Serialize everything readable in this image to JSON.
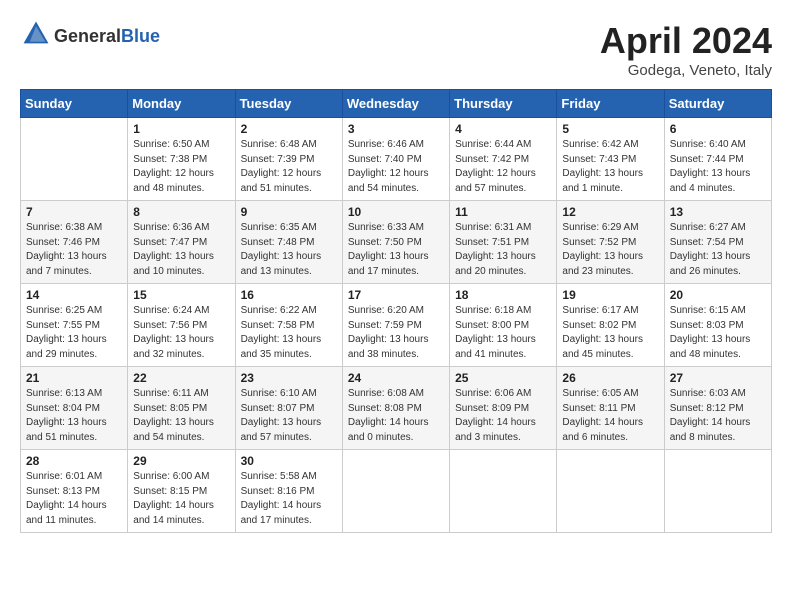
{
  "header": {
    "logo_line1": "General",
    "logo_line2": "Blue",
    "title": "April 2024",
    "subtitle": "Godega, Veneto, Italy"
  },
  "days_of_week": [
    "Sunday",
    "Monday",
    "Tuesday",
    "Wednesday",
    "Thursday",
    "Friday",
    "Saturday"
  ],
  "weeks": [
    [
      {
        "day": "",
        "info": ""
      },
      {
        "day": "1",
        "info": "Sunrise: 6:50 AM\nSunset: 7:38 PM\nDaylight: 12 hours\nand 48 minutes."
      },
      {
        "day": "2",
        "info": "Sunrise: 6:48 AM\nSunset: 7:39 PM\nDaylight: 12 hours\nand 51 minutes."
      },
      {
        "day": "3",
        "info": "Sunrise: 6:46 AM\nSunset: 7:40 PM\nDaylight: 12 hours\nand 54 minutes."
      },
      {
        "day": "4",
        "info": "Sunrise: 6:44 AM\nSunset: 7:42 PM\nDaylight: 12 hours\nand 57 minutes."
      },
      {
        "day": "5",
        "info": "Sunrise: 6:42 AM\nSunset: 7:43 PM\nDaylight: 13 hours\nand 1 minute."
      },
      {
        "day": "6",
        "info": "Sunrise: 6:40 AM\nSunset: 7:44 PM\nDaylight: 13 hours\nand 4 minutes."
      }
    ],
    [
      {
        "day": "7",
        "info": "Sunrise: 6:38 AM\nSunset: 7:46 PM\nDaylight: 13 hours\nand 7 minutes."
      },
      {
        "day": "8",
        "info": "Sunrise: 6:36 AM\nSunset: 7:47 PM\nDaylight: 13 hours\nand 10 minutes."
      },
      {
        "day": "9",
        "info": "Sunrise: 6:35 AM\nSunset: 7:48 PM\nDaylight: 13 hours\nand 13 minutes."
      },
      {
        "day": "10",
        "info": "Sunrise: 6:33 AM\nSunset: 7:50 PM\nDaylight: 13 hours\nand 17 minutes."
      },
      {
        "day": "11",
        "info": "Sunrise: 6:31 AM\nSunset: 7:51 PM\nDaylight: 13 hours\nand 20 minutes."
      },
      {
        "day": "12",
        "info": "Sunrise: 6:29 AM\nSunset: 7:52 PM\nDaylight: 13 hours\nand 23 minutes."
      },
      {
        "day": "13",
        "info": "Sunrise: 6:27 AM\nSunset: 7:54 PM\nDaylight: 13 hours\nand 26 minutes."
      }
    ],
    [
      {
        "day": "14",
        "info": "Sunrise: 6:25 AM\nSunset: 7:55 PM\nDaylight: 13 hours\nand 29 minutes."
      },
      {
        "day": "15",
        "info": "Sunrise: 6:24 AM\nSunset: 7:56 PM\nDaylight: 13 hours\nand 32 minutes."
      },
      {
        "day": "16",
        "info": "Sunrise: 6:22 AM\nSunset: 7:58 PM\nDaylight: 13 hours\nand 35 minutes."
      },
      {
        "day": "17",
        "info": "Sunrise: 6:20 AM\nSunset: 7:59 PM\nDaylight: 13 hours\nand 38 minutes."
      },
      {
        "day": "18",
        "info": "Sunrise: 6:18 AM\nSunset: 8:00 PM\nDaylight: 13 hours\nand 41 minutes."
      },
      {
        "day": "19",
        "info": "Sunrise: 6:17 AM\nSunset: 8:02 PM\nDaylight: 13 hours\nand 45 minutes."
      },
      {
        "day": "20",
        "info": "Sunrise: 6:15 AM\nSunset: 8:03 PM\nDaylight: 13 hours\nand 48 minutes."
      }
    ],
    [
      {
        "day": "21",
        "info": "Sunrise: 6:13 AM\nSunset: 8:04 PM\nDaylight: 13 hours\nand 51 minutes."
      },
      {
        "day": "22",
        "info": "Sunrise: 6:11 AM\nSunset: 8:05 PM\nDaylight: 13 hours\nand 54 minutes."
      },
      {
        "day": "23",
        "info": "Sunrise: 6:10 AM\nSunset: 8:07 PM\nDaylight: 13 hours\nand 57 minutes."
      },
      {
        "day": "24",
        "info": "Sunrise: 6:08 AM\nSunset: 8:08 PM\nDaylight: 14 hours\nand 0 minutes."
      },
      {
        "day": "25",
        "info": "Sunrise: 6:06 AM\nSunset: 8:09 PM\nDaylight: 14 hours\nand 3 minutes."
      },
      {
        "day": "26",
        "info": "Sunrise: 6:05 AM\nSunset: 8:11 PM\nDaylight: 14 hours\nand 6 minutes."
      },
      {
        "day": "27",
        "info": "Sunrise: 6:03 AM\nSunset: 8:12 PM\nDaylight: 14 hours\nand 8 minutes."
      }
    ],
    [
      {
        "day": "28",
        "info": "Sunrise: 6:01 AM\nSunset: 8:13 PM\nDaylight: 14 hours\nand 11 minutes."
      },
      {
        "day": "29",
        "info": "Sunrise: 6:00 AM\nSunset: 8:15 PM\nDaylight: 14 hours\nand 14 minutes."
      },
      {
        "day": "30",
        "info": "Sunrise: 5:58 AM\nSunset: 8:16 PM\nDaylight: 14 hours\nand 17 minutes."
      },
      {
        "day": "",
        "info": ""
      },
      {
        "day": "",
        "info": ""
      },
      {
        "day": "",
        "info": ""
      },
      {
        "day": "",
        "info": ""
      }
    ]
  ]
}
